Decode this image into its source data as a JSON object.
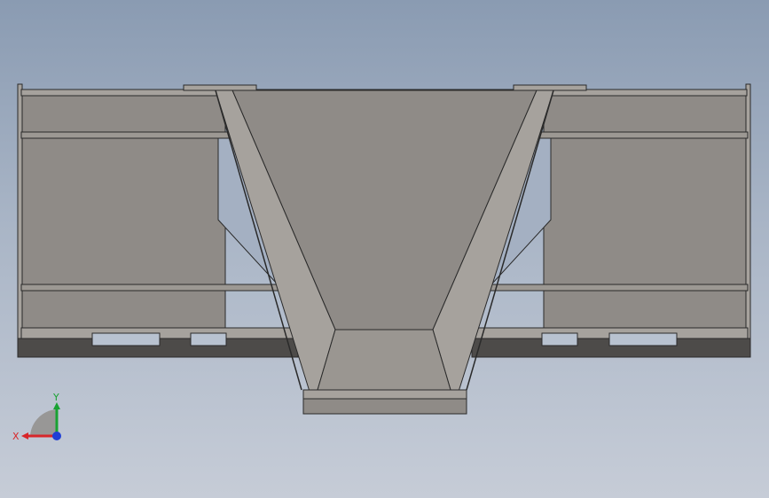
{
  "viewport": {
    "background_top": "#8a9bb2",
    "background_bottom": "#c6ccd7"
  },
  "model": {
    "colors": {
      "face": "#8f8b87",
      "face_light": "#a6a29d",
      "face_dark": "#6e6a66",
      "edge": "#2a2a2a",
      "shadow": "#4d4b49",
      "window": "#a4b0c2"
    }
  },
  "triad": {
    "x_label": "X",
    "y_label": "Y",
    "x_color": "#d8262a",
    "y_color": "#19a233",
    "z_color": "#1f3fd6"
  }
}
